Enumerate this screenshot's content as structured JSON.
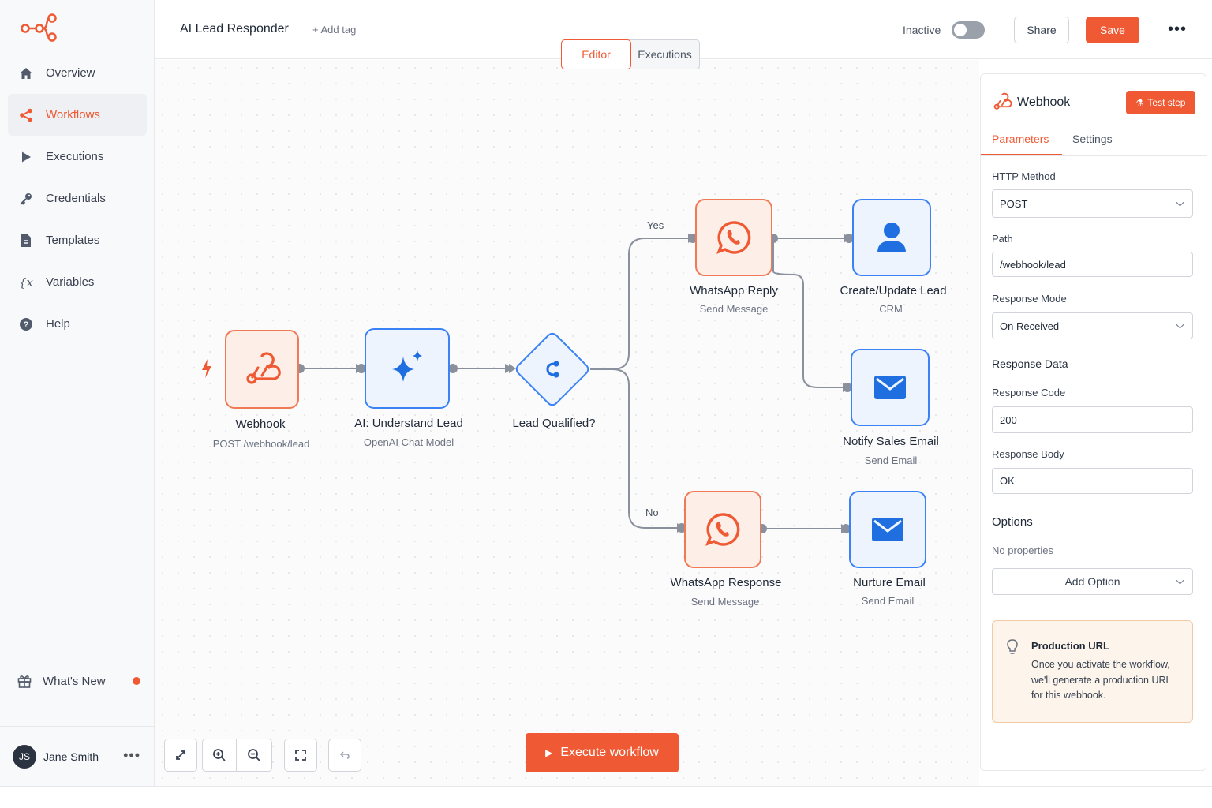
{
  "app": {
    "brand_color": "#ef5a34"
  },
  "sidebar": {
    "items": [
      {
        "label": "Overview",
        "icon": "home-icon"
      },
      {
        "label": "Workflows",
        "icon": "workflows-icon",
        "active": true
      },
      {
        "label": "Executions",
        "icon": "play-icon"
      },
      {
        "label": "Credentials",
        "icon": "key-icon"
      },
      {
        "label": "Templates",
        "icon": "document-icon"
      },
      {
        "label": "Variables",
        "icon": "variables-icon",
        "glyph": "{x"
      },
      {
        "label": "Help",
        "icon": "help-icon"
      }
    ],
    "whats_new": "What's New",
    "user": {
      "initials": "JS",
      "name": "Jane Smith",
      "more": "•••"
    }
  },
  "header": {
    "title": "AI Lead Responder",
    "add_tag": "+ Add tag",
    "inactive_label": "Inactive",
    "active_toggle": false,
    "share": "Share",
    "save": "Save",
    "more": "•••",
    "tabs": [
      {
        "label": "Editor",
        "active": true
      },
      {
        "label": "Executions",
        "active": false
      }
    ]
  },
  "canvas": {
    "nodes": [
      {
        "id": "webhook",
        "label": "Webhook",
        "sub": "POST /webhook/lead",
        "icon": "webhook-icon"
      },
      {
        "id": "ai",
        "label": "AI: Understand Lead",
        "sub": "OpenAI Chat Model",
        "icon": "sparkle-icon"
      },
      {
        "id": "if",
        "label": "Lead Qualified?",
        "sub": "",
        "icon": "branch-icon"
      },
      {
        "id": "wa_reply",
        "label": "WhatsApp Reply",
        "sub": "Send Message",
        "icon": "whatsapp-icon"
      },
      {
        "id": "crm",
        "label": "Create/Update Lead",
        "sub": "CRM",
        "icon": "user-icon"
      },
      {
        "id": "notify",
        "label": "Notify Sales Email",
        "sub": "Send Email",
        "icon": "mail-icon"
      },
      {
        "id": "wa_resp",
        "label": "WhatsApp Response",
        "sub": "Send Message",
        "icon": "whatsapp-icon"
      },
      {
        "id": "nurture",
        "label": "Nurture Email",
        "sub": "Send Email",
        "icon": "mail-icon"
      }
    ],
    "branch_yes": "Yes",
    "branch_no": "No",
    "execute": "Execute workflow",
    "controls": [
      "fit-view-icon",
      "zoom-in-icon",
      "zoom-out-icon",
      "fullscreen-icon",
      "undo-icon"
    ]
  },
  "panel": {
    "title": "Webhook",
    "test_step": "Test step",
    "tabs": [
      {
        "label": "Parameters",
        "active": true
      },
      {
        "label": "Settings",
        "active": false
      }
    ],
    "http_method_label": "HTTP Method",
    "http_method_value": "POST",
    "path_label": "Path",
    "path_value": "/webhook/lead",
    "response_mode_label": "Response Mode",
    "response_mode_value": "On Received",
    "response_data_heading": "Response Data",
    "response_code_label": "Response Code",
    "response_code_value": "200",
    "response_body_label": "Response Body",
    "response_body_value": "OK",
    "options_heading": "Options",
    "no_properties": "No properties",
    "add_option": "Add Option",
    "info_title": "Production URL",
    "info_text": "Once you activate the workflow, we'll generate a production URL for this webhook."
  }
}
